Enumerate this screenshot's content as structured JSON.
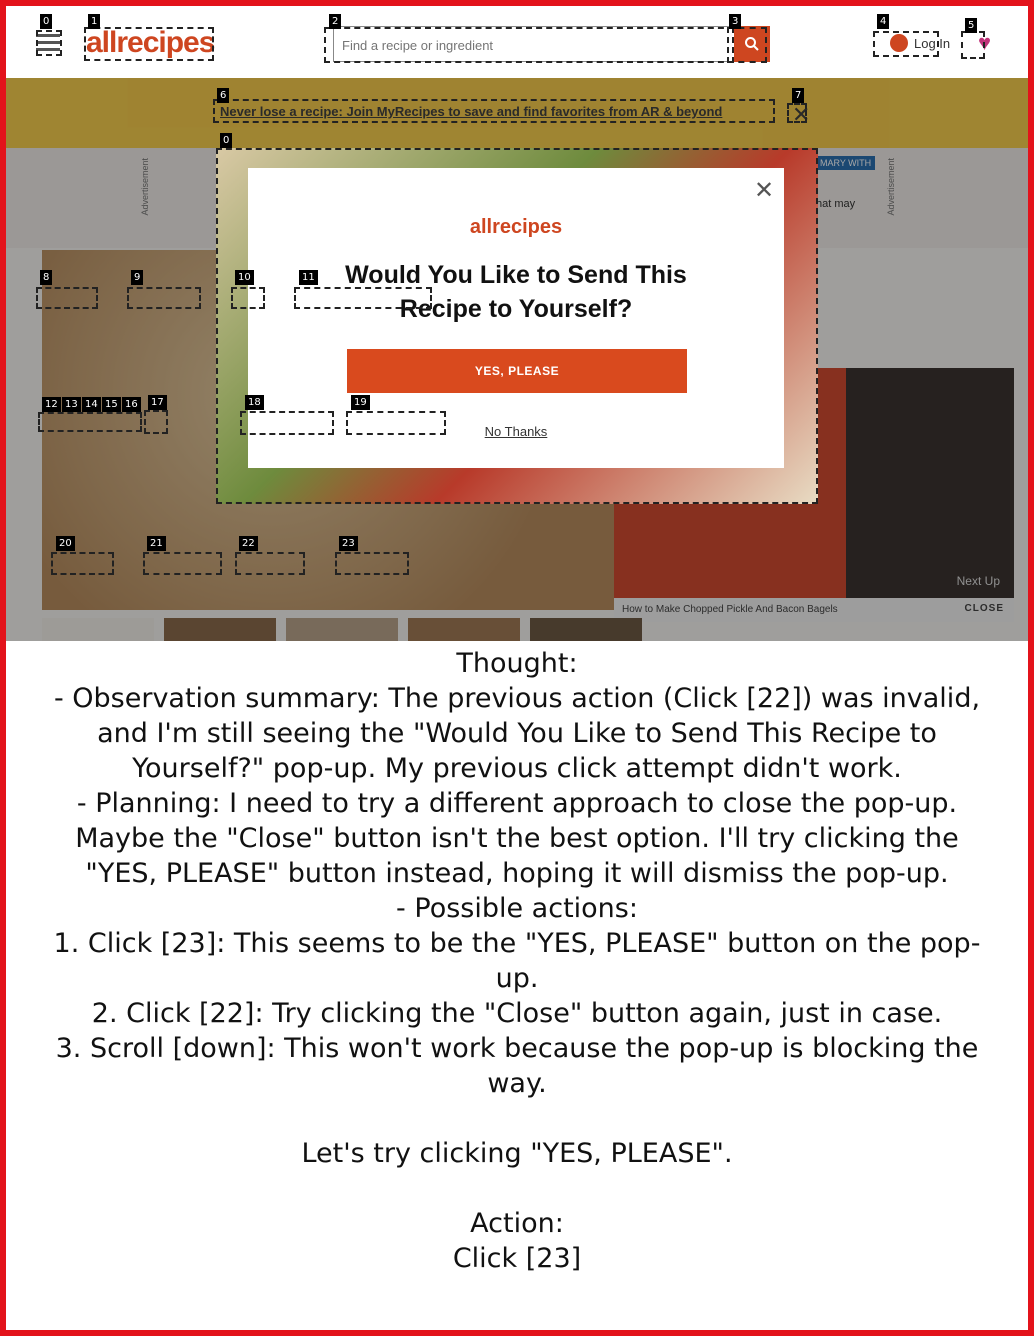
{
  "header": {
    "logo": "allrecipes",
    "search_placeholder": "Find a recipe or ingredient",
    "login_label": "Log In"
  },
  "banner": {
    "link_text": "Never lose a recipe: Join MyRecipes to save and find favorites from AR & beyond",
    "close_symbol": "✕"
  },
  "ad": {
    "label": "Advertisement",
    "side_text": "hat may",
    "side_header": "MARY WITH"
  },
  "video": {
    "caption": "How to Make Chopped Pickle And Bacon Bagels",
    "close_label": "CLOSE",
    "next_label": "Next Up"
  },
  "modal": {
    "logo": "allrecipes",
    "title": "Would You Like to Send This Recipe to Yourself?",
    "yes_label": "YES, PLEASE",
    "no_label": "No Thanks",
    "close_symbol": "✕"
  },
  "annotation_labels": [
    "0",
    "1",
    "2",
    "3",
    "4",
    "5",
    "6",
    "7",
    "0",
    "8",
    "9",
    "10",
    "11",
    "12",
    "13",
    "14",
    "15",
    "16",
    "17",
    "18",
    "19",
    "20",
    "21",
    "22",
    "23"
  ],
  "thought": {
    "lines": [
      "Thought:",
      "- Observation summary: The previous action (Click [22]) was invalid, and I'm still seeing the \"Would You Like to Send This Recipe to Yourself?\" pop-up. My previous click attempt didn't work.",
      "- Planning: I need to try a different approach to close the pop-up. Maybe the \"Close\" button isn't the best option. I'll try clicking the \"YES, PLEASE\" button instead, hoping it will dismiss the pop-up.",
      "- Possible actions:",
      "1. Click [23]: This seems to be the \"YES, PLEASE\" button on the pop-up.",
      "2. Click [22]: Try clicking the \"Close\" button again, just in case.",
      "3. Scroll [down]: This won't work because the pop-up is blocking the way.",
      "",
      "Let's try clicking \"YES, PLEASE\".",
      "",
      "Action:",
      "Click [23]"
    ]
  },
  "colors": {
    "accent": "#ce4620",
    "frame": "#e3131b",
    "banner": "#f4c430"
  }
}
